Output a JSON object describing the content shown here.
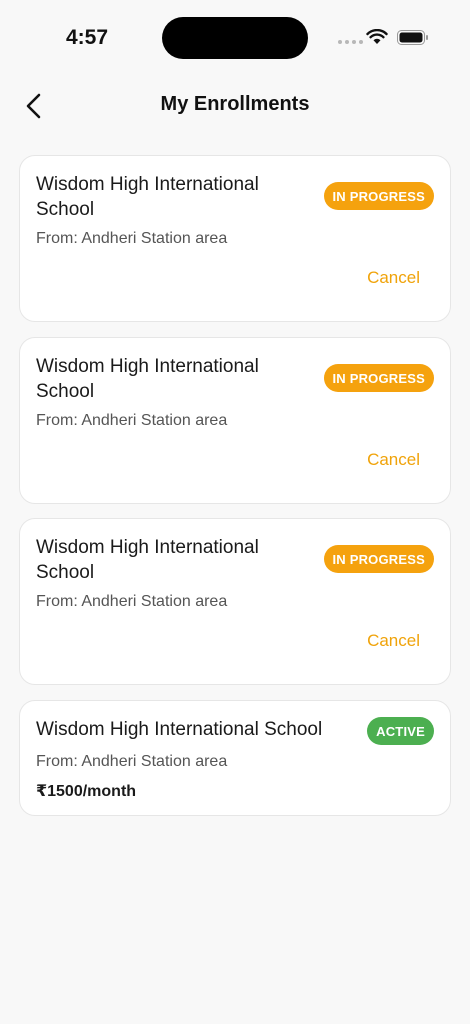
{
  "status_bar": {
    "time": "4:57"
  },
  "header": {
    "title": "My Enrollments"
  },
  "colors": {
    "accent": "#f5a20e",
    "active": "#4caf50"
  },
  "enrollments": [
    {
      "school": "Wisdom High International School",
      "status": "IN PROGRESS",
      "from": "From: Andheri Station area",
      "action": "Cancel"
    },
    {
      "school": "Wisdom High International School",
      "status": "IN PROGRESS",
      "from": "From: Andheri Station area",
      "action": "Cancel"
    },
    {
      "school": "Wisdom High International School",
      "status": "IN PROGRESS",
      "from": "From: Andheri Station area",
      "action": "Cancel"
    },
    {
      "school": "Wisdom High International School",
      "status": "ACTIVE",
      "from": "From: Andheri Station area",
      "price": "₹1500/month"
    }
  ]
}
